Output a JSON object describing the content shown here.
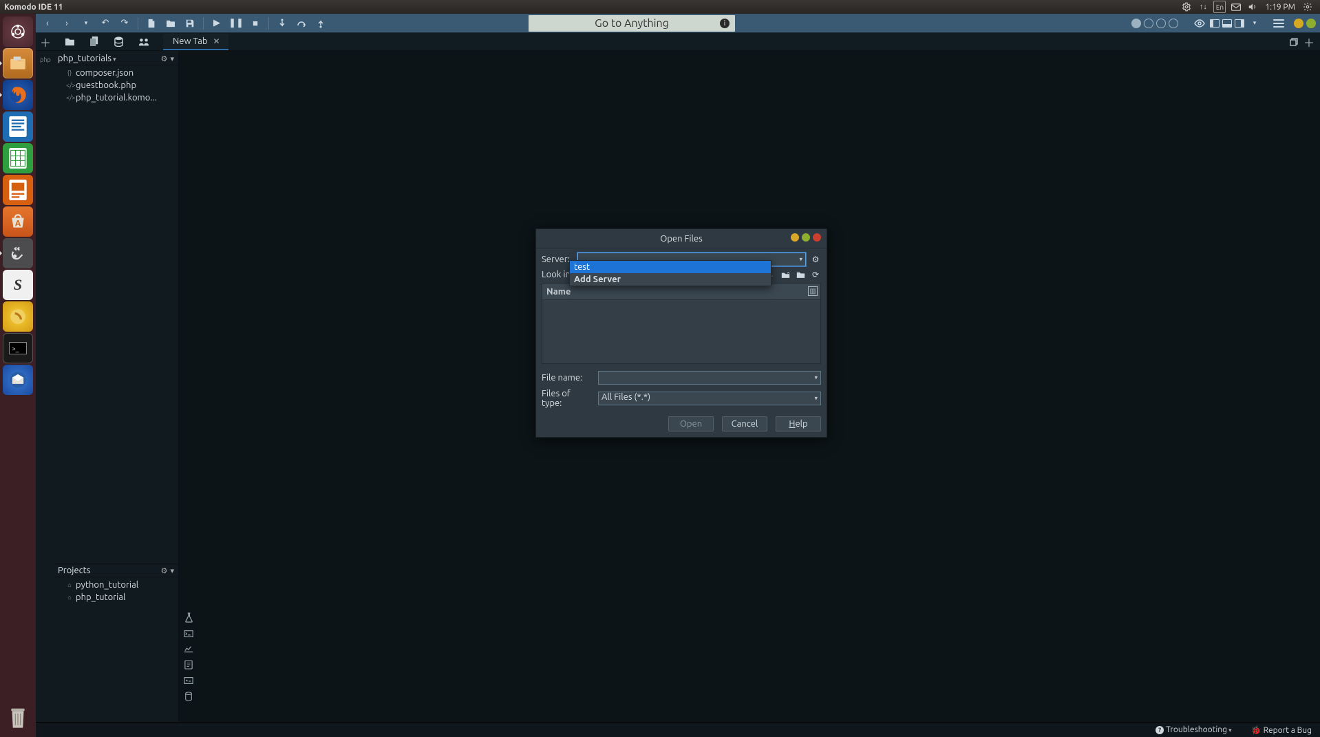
{
  "os": {
    "app_title": "Komodo IDE 11",
    "lang": "En",
    "time": "1:19 PM"
  },
  "launcher": {
    "items": [
      "dash",
      "files",
      "firefox",
      "writer",
      "calc",
      "impress",
      "software",
      "settings",
      "slack",
      "octave",
      "terminal",
      "thunderbird",
      "trash"
    ]
  },
  "toolbar": {
    "goto_placeholder": "Go to Anything"
  },
  "tabs": {
    "active_label": "New Tab"
  },
  "sidebar": {
    "project_name": "php_tutorials",
    "files": [
      {
        "icon": "{}",
        "name": "composer.json"
      },
      {
        "icon": "</>",
        "name": "guestbook.php"
      },
      {
        "icon": "</>",
        "name": "php_tutorial.komo..."
      }
    ],
    "projects_header": "Projects",
    "projects": [
      {
        "name": "python_tutorial"
      },
      {
        "name": "php_tutorial"
      }
    ]
  },
  "dialog": {
    "title": "Open Files",
    "server_label": "Server:",
    "lookin_label": "Look in:",
    "name_header": "Name",
    "dropdown": {
      "options": [
        "test",
        "Add Server"
      ],
      "selected": "test"
    },
    "filename_label": "File name:",
    "filename_value": "",
    "filetype_label": "Files of type:",
    "filetype_value": "All Files (*.*)",
    "buttons": {
      "open": "Open",
      "cancel": "Cancel",
      "help": "Help"
    }
  },
  "status": {
    "troubleshoot": "Troubleshooting",
    "report": "Report a Bug"
  }
}
